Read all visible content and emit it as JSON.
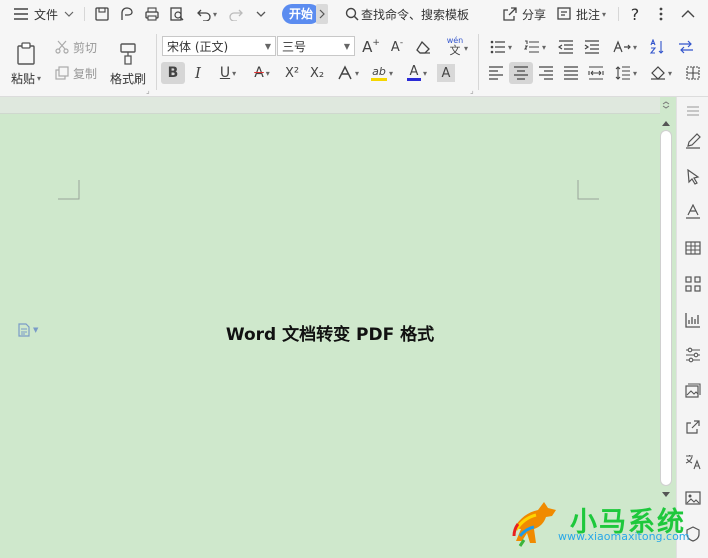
{
  "menubar": {
    "file": "文件",
    "start_tab": "开始",
    "search_text": "查找命令、搜索模板",
    "share": "分享",
    "annotate": "批注",
    "help": "?"
  },
  "ribbon": {
    "paste": "粘贴",
    "cut": "剪切",
    "copy": "复制",
    "format_painter": "格式刷",
    "font_name": "宋体 (正文)",
    "font_size": "三号",
    "bold": "B",
    "italic": "I",
    "underline": "U",
    "strike": "A",
    "superscript": "X²",
    "subscript": "X₂",
    "phonetic": "wén",
    "char_shading": "A"
  },
  "document": {
    "title": "Word 文档转变 PDF 格式"
  },
  "watermark": {
    "brand": "小马系统",
    "url": "www.xiaomaxitong.com"
  },
  "colors": {
    "page_bg": "#cfe8cc",
    "accent": "#5b8cf0",
    "font_color": "#2b2bd6",
    "highlight": "#f5d600"
  }
}
